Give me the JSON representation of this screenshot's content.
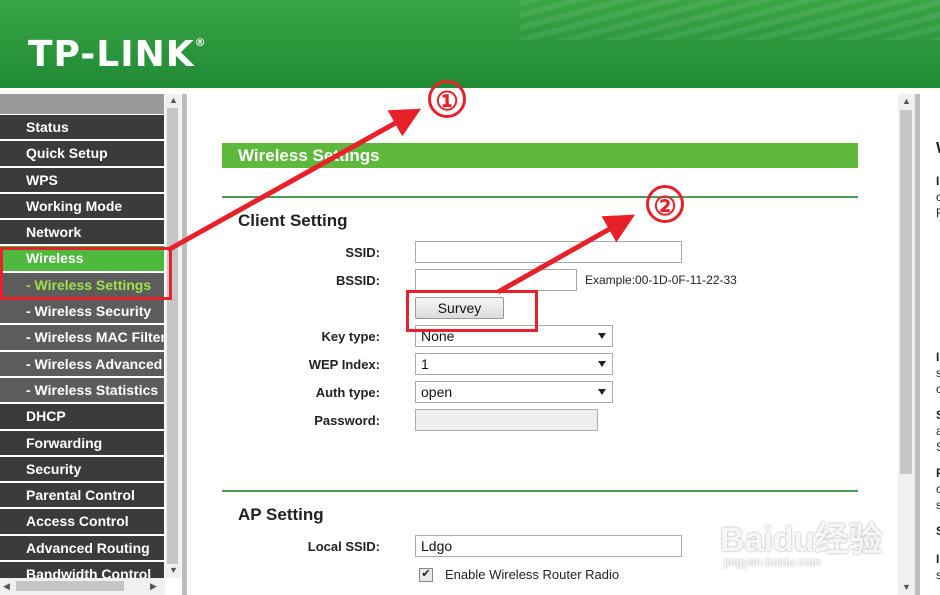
{
  "brand": {
    "logo_text": "TP-LINK",
    "registered_mark": "®",
    "header_color": "#2a9a3c"
  },
  "sidebar": {
    "items": [
      {
        "label": "Status",
        "level": 0
      },
      {
        "label": "Quick Setup",
        "level": 0
      },
      {
        "label": "WPS",
        "level": 0
      },
      {
        "label": "Working Mode",
        "level": 0
      },
      {
        "label": "Network",
        "level": 0
      },
      {
        "label": "Wireless",
        "level": 0,
        "active": true
      },
      {
        "label": "- Wireless Settings",
        "level": 1,
        "active": true
      },
      {
        "label": "- Wireless Security",
        "level": 1
      },
      {
        "label": "- Wireless MAC Filtering",
        "level": 1
      },
      {
        "label": "- Wireless Advanced",
        "level": 1
      },
      {
        "label": "- Wireless Statistics",
        "level": 1
      },
      {
        "label": "DHCP",
        "level": 0
      },
      {
        "label": "Forwarding",
        "level": 0
      },
      {
        "label": "Security",
        "level": 0
      },
      {
        "label": "Parental Control",
        "level": 0
      },
      {
        "label": "Access Control",
        "level": 0
      },
      {
        "label": "Advanced Routing",
        "level": 0
      },
      {
        "label": "Bandwidth Control",
        "level": 0
      }
    ]
  },
  "main": {
    "section_title": "Wireless Settings",
    "client": {
      "title": "Client Setting",
      "ssid_label": "SSID:",
      "ssid_value": "",
      "bssid_label": "BSSID:",
      "bssid_value": "",
      "bssid_example": "Example:00-1D-0F-11-22-33",
      "survey_label": "Survey",
      "key_type_label": "Key type:",
      "key_type_value": "None",
      "wep_index_label": "WEP Index:",
      "wep_index_value": "1",
      "auth_type_label": "Auth type:",
      "auth_type_value": "open",
      "password_label": "Password:",
      "password_value": ""
    },
    "ap": {
      "title": "AP Setting",
      "local_ssid_label": "Local SSID:",
      "local_ssid_value": "Ldgo",
      "enable_radio_label": "Enable Wireless Router Radio",
      "enable_radio_checked": true
    }
  },
  "help_pane": {
    "visible_chars": [
      "W",
      "I",
      "c",
      "F",
      "I",
      "s",
      "c",
      "S",
      "a",
      "S",
      "F",
      "c",
      "s",
      "S",
      "I",
      "s"
    ]
  },
  "annotations": {
    "step1": "①",
    "step2": "②",
    "color": "#e8202a"
  },
  "watermark": {
    "text": "Baidu经验",
    "url": "jingyan.baidu.com"
  }
}
